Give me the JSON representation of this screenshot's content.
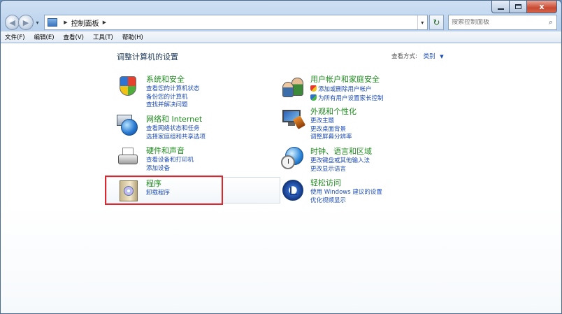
{
  "window": {
    "close_label": "x"
  },
  "navbar": {
    "back_glyph": "◀",
    "forward_glyph": "▶",
    "address_sep1": "▶",
    "address_text": "控制面板",
    "address_sep2": "▶",
    "dropdown_glyph": "▾",
    "refresh_glyph": "↻",
    "search_placeholder": "搜索控制面板",
    "search_glyph": "⌕"
  },
  "menu": [
    {
      "label": "文件(F)"
    },
    {
      "label": "编辑(E)"
    },
    {
      "label": "查看(V)"
    },
    {
      "label": "工具(T)"
    },
    {
      "label": "帮助(H)"
    }
  ],
  "content": {
    "title": "调整计算机的设置",
    "view_by_label": "查看方式:",
    "view_by_value": "类别",
    "view_by_arrow": "▼"
  },
  "categories": {
    "system": {
      "heading": "系统和安全",
      "links": [
        "查看您的计算机状态",
        "备份您的计算机",
        "查找并解决问题"
      ]
    },
    "network": {
      "heading": "网络和 Internet",
      "links": [
        "查看网络状态和任务",
        "选择家庭组和共享选项"
      ]
    },
    "hardware": {
      "heading": "硬件和声音",
      "links": [
        "查看设备和打印机",
        "添加设备"
      ]
    },
    "programs": {
      "heading": "程序",
      "links": [
        "卸载程序"
      ]
    },
    "users": {
      "heading": "用户帐户和家庭安全",
      "links": [
        "添加或删除用户帐户",
        "为所有用户设置家长控制"
      ]
    },
    "appearance": {
      "heading": "外观和个性化",
      "links": [
        "更改主题",
        "更改桌面背景",
        "调整屏幕分辨率"
      ]
    },
    "clock": {
      "heading": "时钟、语言和区域",
      "links": [
        "更改键盘或其他输入法",
        "更改显示语言"
      ]
    },
    "ease": {
      "heading": "轻松访问",
      "links": [
        "使用 Windows 建议的设置",
        "优化视频显示"
      ]
    }
  }
}
